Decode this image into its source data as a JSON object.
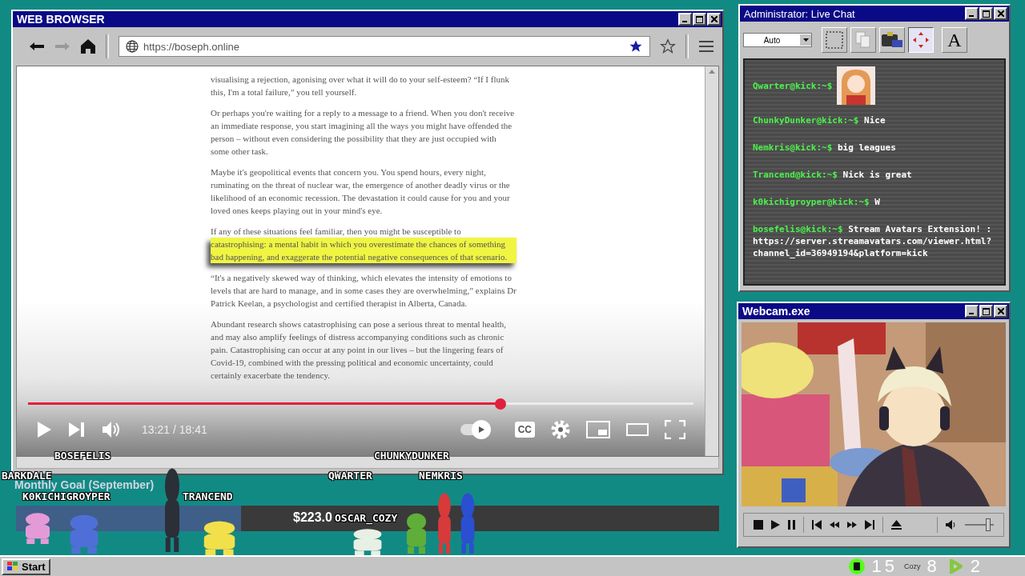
{
  "browser": {
    "title": "WEB BROWSER",
    "url": "https://boseph.online",
    "bookmarked": true,
    "article": [
      {
        "kind": "text",
        "text": "visualising a rejection, agonising over what it will do to your self-esteem? “If I flunk this, I'm a total failure,” you tell yourself."
      },
      {
        "kind": "text",
        "text": "Or perhaps you're waiting for a reply to a message to a friend. When you don't receive an immediate response, you start imagining all the ways you might have offended the person – without even considering the possibility that they are just occupied with some other task."
      },
      {
        "kind": "text",
        "text": "Maybe it's geopolitical events that concern you. You spend hours, every night, ruminating on the threat of nuclear war, the emergence of another deadly virus or the likelihood of an economic recession. The devastation it could cause for you and your loved ones keeps playing out in your mind's eye."
      },
      {
        "kind": "lead",
        "text": "If any of these situations feel familiar, then you might be susceptible to"
      },
      {
        "kind": "highlight",
        "text": "catastrophising: a mental habit in which you overestimate the chances of something bad happening, and exaggerate the potential negative consequences of that scenario."
      },
      {
        "kind": "text",
        "text": "“It's a negatively skewed way of thinking, which elevates the intensity of emotions to levels that are hard to manage, and in some cases they are overwhelming,” explains Dr Patrick Keelan, a psychologist and certified therapist in Alberta, Canada."
      },
      {
        "kind": "text",
        "text": "Abundant research shows catastrophising can pose a serious threat to mental health, and may also amplify feelings of distress accompanying conditions such as chronic pain. Catastrophising can occur at any point in our lives – but the lingering fears of Covid-19, combined with the pressing political and economic uncertainty, could certainly exacerbate the tendency."
      }
    ],
    "player": {
      "time": "13:21 / 18:41",
      "level": 0.71,
      "autoplay": true,
      "cc": "CC"
    }
  },
  "chat": {
    "title": "Administrator: Live Chat",
    "quality": "Auto",
    "font_button": "A",
    "messages": [
      {
        "kind": "emote",
        "user": "Qwarter@kick:~$"
      },
      {
        "kind": "text",
        "user": "ChunkyDunker@kick:~$",
        "text": "Nice"
      },
      {
        "kind": "text",
        "user": "Nemkris@kick:~$",
        "text": "big leagues"
      },
      {
        "kind": "text",
        "user": "Trancend@kick:~$",
        "text": "Nick is great"
      },
      {
        "kind": "text",
        "user": "k0kichigroyper@kick:~$",
        "text": "W"
      },
      {
        "kind": "text",
        "user": "bosefelis@kick:~$",
        "text": "Stream Avatars Extension! : https://server.streamavatars.com/viewer.html?channel_id=36949194&platform=kick"
      }
    ]
  },
  "webcam": {
    "title": "Webcam.exe",
    "volume": {
      "level": 0.8
    }
  },
  "overlay": {
    "goal": {
      "title": "Monthly Goal (September)",
      "amount": "$223.0",
      "level": 0.32
    },
    "avatars": [
      {
        "name": "BOSEFELIS",
        "color": "#2a2f38"
      },
      {
        "name": "BARKDALE",
        "color": "#e59ad8"
      },
      {
        "name": "K0KICHIGROYPER",
        "color": "#4f6fd8"
      },
      {
        "name": "TRANCEND",
        "color": "#f2e04a"
      },
      {
        "name": "QWARTER",
        "color": "#5fae3a"
      },
      {
        "name": "OSCAR_COZY",
        "color": "#e8efe4"
      },
      {
        "name": "CHUNKYDUNKER",
        "color": "#d83a3a"
      },
      {
        "name": "NEMKRIS",
        "color": "#2a4fd0"
      }
    ]
  },
  "taskbar": {
    "start": "Start",
    "stats": [
      {
        "kind": "kick",
        "count": "15"
      },
      {
        "kind": "cozy",
        "label": "Cozy",
        "count": "8"
      },
      {
        "kind": "rumble",
        "count": "2"
      }
    ]
  }
}
